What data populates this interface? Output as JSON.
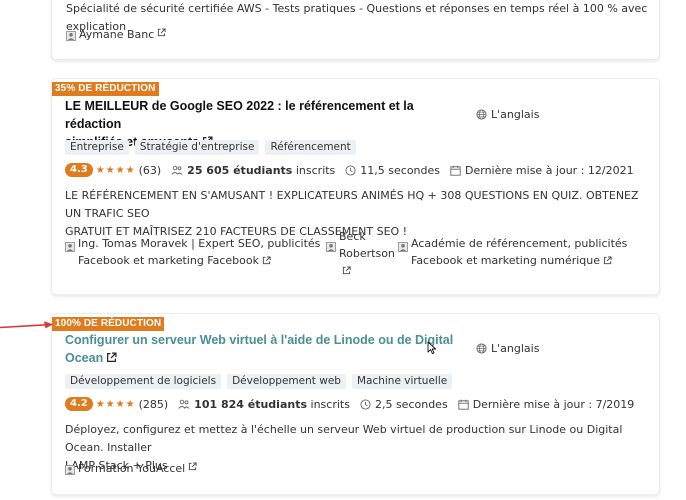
{
  "top_card": {
    "description": "Spécialité de sécurité certifiée AWS - Tests pratiques - Questions et réponses en temps réel à 100 % avec explication",
    "instructor": "Aymane Banc"
  },
  "course1": {
    "discount": "35% DE RÉDUCTION",
    "title_line1": "LE MEILLEUR de Google SEO 2022 : le référencement et la rédaction",
    "title_line2": "simplifiés et amusants",
    "language": "L'anglais",
    "tags": [
      "Entreprise",
      "Stratégie d'entreprise",
      "Référencement"
    ],
    "rating": "4.3",
    "stars": "★★★★",
    "reviews": "(63)",
    "students": "25 605 étudiants",
    "students_suffix": "inscrits",
    "duration": "11,5 secondes",
    "updated": "Dernière mise à jour : 12/2021",
    "description_line1": "LE RÉFÉRENCEMENT EN S'AMUSANT ! EXPLICATEURS ANIMÉS HQ + 308 QUESTIONS EN QUIZ. OBTENEZ UN TRAFIC SEO",
    "description_line2": "GRATUIT ET MAÎTRISEZ 210 FACTEURS DE CLASSEMENT SEO !",
    "instructors": [
      {
        "line1": "Ing. Tomas Moravek | Expert SEO, publicités",
        "line2": "Facebook et marketing Facebook"
      },
      {
        "line1": "Beck",
        "line2": "Robertson"
      },
      {
        "line1": "Académie de référencement, publicités",
        "line2": "Facebook et marketing numérique"
      }
    ]
  },
  "course2": {
    "discount": "100% DE RÉDUCTION",
    "title_line1": "Configurer un serveur Web virtuel à l'aide de Linode ou de Digital",
    "title_line2": "Ocean",
    "language": "L'anglais",
    "tags": [
      "Développement de logiciels",
      "Développement web",
      "Machine virtuelle"
    ],
    "rating": "4.2",
    "stars": "★★★★",
    "reviews": "(285)",
    "students": "101 824 étudiants",
    "students_suffix": "inscrits",
    "duration": "2,5 secondes",
    "updated": "Dernière mise à jour : 7/2019",
    "description_line1": "Déployez, configurez et mettez à l'échelle un serveur Web virtuel de production sur Linode ou Digital Ocean. Installer",
    "description_line2": "LAMP Stack + Plus",
    "instructor": "Formation YouAccel"
  },
  "colors": {
    "discount_badge": "#e07b1e",
    "teal_title": "#4a8f97",
    "arrow": "#d9363e"
  }
}
